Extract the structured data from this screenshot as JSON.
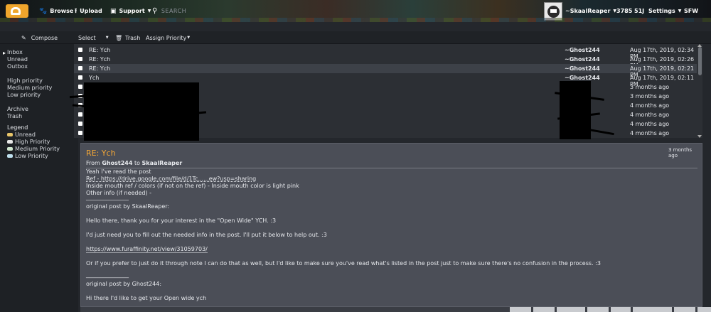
{
  "topbar": {
    "browse": "Browse",
    "upload": "Upload",
    "support": "Support",
    "search_placeholder": "SEARCH",
    "username": "~SkaalReaper",
    "stats": "3785 51J",
    "settings": "Settings",
    "sfw": "SFW"
  },
  "toolbar": {
    "compose": "Compose",
    "select": "Select",
    "trash": "Trash",
    "assign_priority": "Assign Priority"
  },
  "sidebar": {
    "folders": [
      "Inbox",
      "Unread",
      "Outbox"
    ],
    "priorities": [
      "High priority",
      "Medium priority",
      "Low priority"
    ],
    "other": [
      "Archive",
      "Trash"
    ],
    "legend_title": "Legend",
    "legend": [
      {
        "label": "Unread",
        "color": "#e8c56a"
      },
      {
        "label": "High Priority",
        "color": "#e8e8e8"
      },
      {
        "label": "Medium Priority",
        "color": "#cfe6cf"
      },
      {
        "label": "Low Priority",
        "color": "#bfe0ee"
      }
    ]
  },
  "messages": [
    {
      "subject": "RE: Ych",
      "from": "~Ghost244",
      "date": "Aug 17th, 2019, 02:34 PM"
    },
    {
      "subject": "RE: Ych",
      "from": "~Ghost244",
      "date": "Aug 17th, 2019, 02:26 PM"
    },
    {
      "subject": "RE: Ych",
      "from": "~Ghost244",
      "date": "Aug 17th, 2019, 02:21 PM"
    },
    {
      "subject": "Ych",
      "from": "~Ghost244",
      "date": "Aug 17th, 2019, 02:11 PM"
    },
    {
      "subject": "",
      "from": "",
      "date": "3 months ago"
    },
    {
      "subject": "",
      "from": "",
      "date": "3 months ago"
    },
    {
      "subject": "",
      "from": "",
      "date": "4 months ago"
    },
    {
      "subject": "",
      "from": "",
      "date": "4 months ago"
    },
    {
      "subject": "",
      "from": "",
      "date": "4 months ago"
    },
    {
      "subject": "",
      "from": "",
      "date": "4 months ago"
    }
  ],
  "message_view": {
    "title": "RE: Ych",
    "time": "3 months ago",
    "from_prefix": "From",
    "from_user": "Ghost244",
    "to_word": "to",
    "to_user": "SkaalReaper",
    "lines": [
      "Yeah I've read the post",
      "Ref - https://drive.google.com/file/d/1Tc......ew?usp=sharing",
      "Inside mouth ref / colors (if not on the ref) - Inside mouth color is light pink",
      "Other info (if needed) -",
      "_______________",
      "original post by SkaalReaper:",
      "Hello there, thank you for your interest in the \"Open Wide\" YCH. :3",
      "I'd just need you to fill out the needed info in the post. I'll put it below to help out. :3",
      "https://www.furaffinity.net/view/31059703/",
      "Or if you prefer to just do it through note I can do that as well, but I'd like to make sure you've read what's listed in the post just to make sure there's no confusion in the process. :3",
      "_______________",
      "original post by Ghost244:",
      "Hi there I'd like to get your Open wide ych"
    ]
  }
}
